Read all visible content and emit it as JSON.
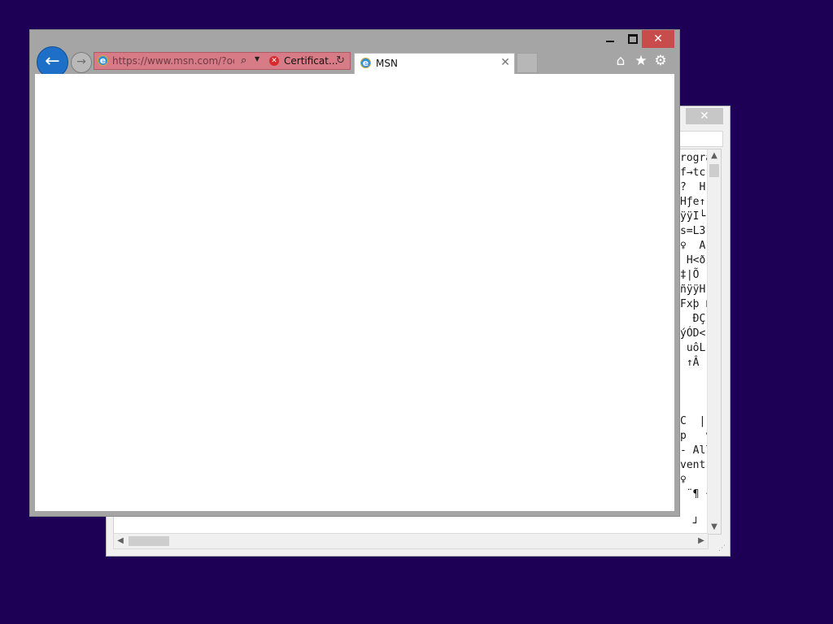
{
  "browser": {
    "address": {
      "url_domain": "https://www.msn.com",
      "url_path": "/?ocid",
      "certificate_label": "Certificat..."
    },
    "tab": {
      "title": "MSN"
    },
    "toolbar_icons": [
      "home-icon",
      "star-icon",
      "gear-icon"
    ]
  },
  "background_window": {
    "text_lines": [
      "rogra",
      "f→tc",
      "?  H",
      "Hƒe↑",
      "ÿÿI└",
      "s=L3",
      "♀  A",
      " H<ð",
      "‡|Õ",
      "ñÿÿH",
      "Fxþ ß",
      "  ÐÇ",
      "ýÓD<",
      " uôL",
      " ↑Â",
      "",
      "",
      "",
      "C  |",
      "p   v",
      "- All",
      "vent",
      "♀   ¨",
      " ¨¶ ♦",
      "",
      "  ┘"
    ]
  },
  "colors": {
    "desktop": "#1d0055",
    "address_error": "#d77b87",
    "back_button": "#1e6fc8",
    "close_button": "#c94c4c"
  }
}
